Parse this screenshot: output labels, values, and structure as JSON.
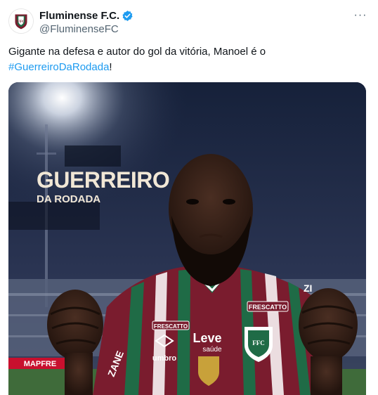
{
  "author": {
    "display_name": "Fluminense F.C.",
    "handle": "@FluminenseFC",
    "verified_icon": "verified-badge-icon",
    "avatar_icon": "fluminense-crest-icon"
  },
  "menu": {
    "more_icon": "more-horizontal-icon",
    "label": "···"
  },
  "tweet": {
    "text_before": "Gigante na defesa e autor do gol da vitória, Manoel é o",
    "hashtag": "#GuerreiroDaRodada",
    "text_after": "!"
  },
  "media": {
    "headline": "GUERREIRO",
    "subheadline": "DA RODADA",
    "sponsor_chest": "Leve",
    "sponsor_chest_sub": "saúde",
    "kit_brand": "umbro",
    "collar_sponsor": "FRESCATTO",
    "sleeve_text": "FRESCATTO",
    "board_ad": "MAPFRE",
    "sleeve_side": "ZANE",
    "shoulder_text": "ZI"
  },
  "colors": {
    "link": "#1d9bf0",
    "secondary_text": "#536471",
    "fluminense_maroon": "#7a1c2e",
    "fluminense_green": "#1f6b46"
  }
}
